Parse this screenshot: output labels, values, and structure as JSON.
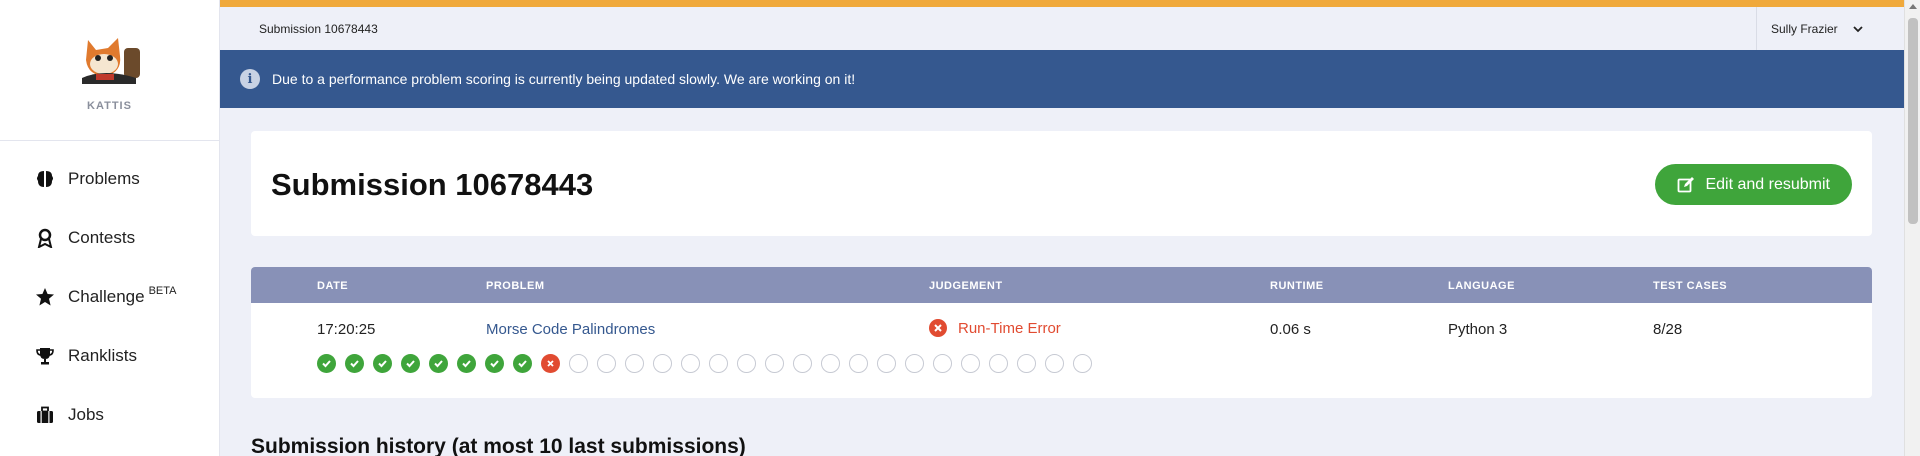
{
  "brand": {
    "name": "KATTIS",
    "logo_icon": "kattis-cat-logo"
  },
  "sidebar": {
    "items": [
      {
        "label": "Problems",
        "icon": "brain-icon"
      },
      {
        "label": "Contests",
        "icon": "award-icon"
      },
      {
        "label": "Challenge",
        "icon": "star-icon",
        "badge": "BETA"
      },
      {
        "label": "Ranklists",
        "icon": "trophy-icon"
      },
      {
        "label": "Jobs",
        "icon": "briefcase-icon"
      }
    ]
  },
  "topbar": {
    "breadcrumb": "Submission 10678443",
    "user": "Sully Frazier",
    "accent_color": "#f0a93b"
  },
  "banner": {
    "message": "Due to a performance problem scoring is currently being updated slowly. We are working on it!",
    "color": "#35588f"
  },
  "header": {
    "title": "Submission 10678443",
    "resubmit_label": "Edit and resubmit",
    "button_color": "#3fa53b"
  },
  "table": {
    "columns": [
      "DATE",
      "PROBLEM",
      "JUDGEMENT",
      "RUNTIME",
      "LANGUAGE",
      "TEST CASES"
    ],
    "row": {
      "date": "17:20:25",
      "problem": "Morse Code Palindromes",
      "judgement": "Run-Time Error",
      "runtime": "0.06 s",
      "language": "Python 3",
      "test_cases": "8/28"
    },
    "test_results": [
      "pass",
      "pass",
      "pass",
      "pass",
      "pass",
      "pass",
      "pass",
      "pass",
      "fail",
      "none",
      "none",
      "none",
      "none",
      "none",
      "none",
      "none",
      "none",
      "none",
      "none",
      "none",
      "none",
      "none",
      "none",
      "none",
      "none",
      "none",
      "none",
      "none"
    ]
  },
  "history_heading": "Submission history (at most 10 last submissions)"
}
